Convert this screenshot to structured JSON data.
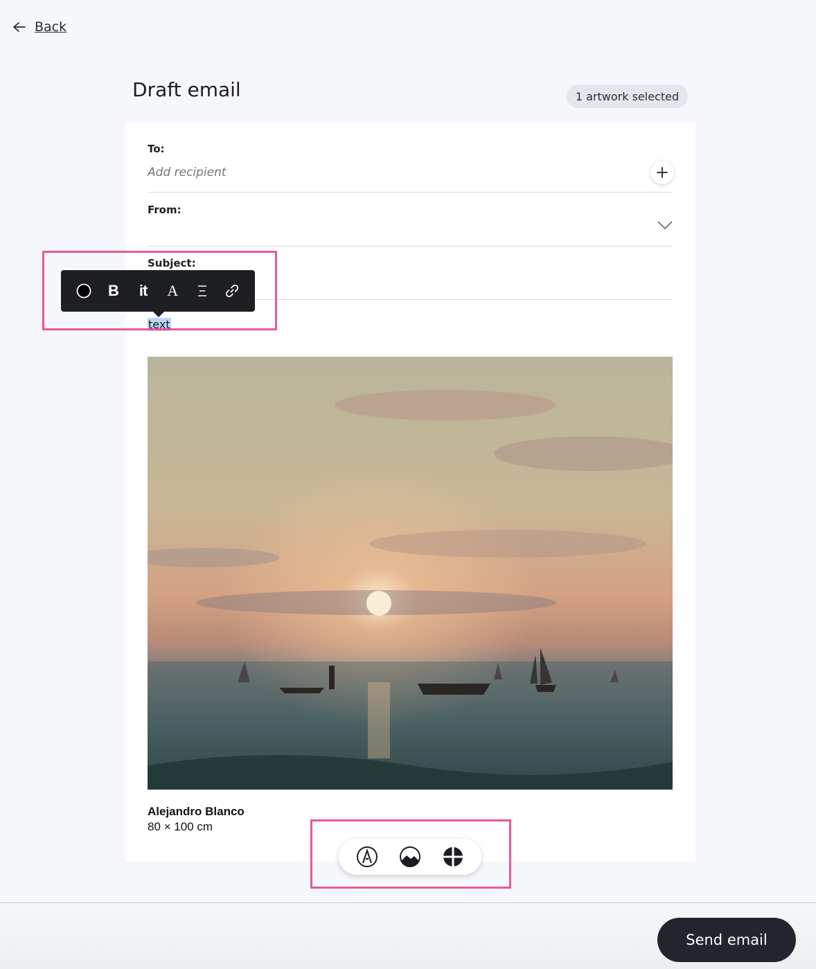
{
  "nav": {
    "back_label": "Back"
  },
  "header": {
    "title": "Draft email",
    "badge": "1 artwork selected"
  },
  "form": {
    "to_label": "To:",
    "to_placeholder": "Add recipient",
    "from_label": "From:",
    "subject_label": "Subject:"
  },
  "body": {
    "selected_text": "text"
  },
  "formatting_toolbar": {
    "tools": [
      "color-circle-icon",
      "bold",
      "italic",
      "font-style",
      "align",
      "link-icon"
    ],
    "bold_label": "B",
    "italic_label": "it",
    "font_label": "A"
  },
  "artwork": {
    "artist": "Alejandro Blanco",
    "dimensions": "80 × 100 cm"
  },
  "insert_toolbar": {
    "tools": [
      "pen-icon",
      "image-icon",
      "add-block-icon"
    ]
  },
  "footer": {
    "send_label": "Send email"
  },
  "colors": {
    "highlight": "#e8579a",
    "primary_button": "#22252e",
    "selection": "#b9d4f4"
  }
}
